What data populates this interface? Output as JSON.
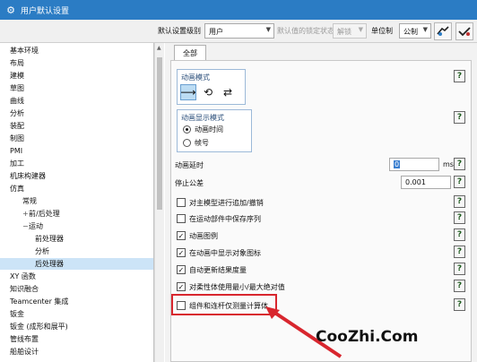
{
  "window": {
    "title": "用户默认设置"
  },
  "toolbar": {
    "default_level_label": "默认设置级别",
    "default_level_value": "用户",
    "lock_state_label": "默认值的锁定状态",
    "lock_state_value": "解锁",
    "unit_label": "单位制",
    "unit_value": "公制",
    "icons": [
      "settings-tool-icon",
      "check-tool-icon"
    ]
  },
  "sidebar": {
    "items": [
      {
        "label": "基本环境",
        "depth": 0,
        "expander": ""
      },
      {
        "label": "布局",
        "depth": 0,
        "expander": ""
      },
      {
        "label": "建模",
        "depth": 0,
        "expander": ""
      },
      {
        "label": "草图",
        "depth": 0,
        "expander": ""
      },
      {
        "label": "曲线",
        "depth": 0,
        "expander": ""
      },
      {
        "label": "分析",
        "depth": 0,
        "expander": ""
      },
      {
        "label": "装配",
        "depth": 0,
        "expander": ""
      },
      {
        "label": "制图",
        "depth": 0,
        "expander": ""
      },
      {
        "label": "PMI",
        "depth": 0,
        "expander": ""
      },
      {
        "label": "加工",
        "depth": 0,
        "expander": ""
      },
      {
        "label": "机床构建器",
        "depth": 0,
        "expander": ""
      },
      {
        "label": "仿真",
        "depth": 0,
        "expander": ""
      },
      {
        "label": "常规",
        "depth": 1,
        "expander": ""
      },
      {
        "label": "前/后处理",
        "depth": 1,
        "expander": "+"
      },
      {
        "label": "运动",
        "depth": 1,
        "expander": "−"
      },
      {
        "label": "前处理器",
        "depth": 2,
        "expander": ""
      },
      {
        "label": "分析",
        "depth": 2,
        "expander": ""
      },
      {
        "label": "后处理器",
        "depth": 2,
        "expander": "",
        "selected": true
      },
      {
        "label": "XY 函数",
        "depth": 0,
        "expander": ""
      },
      {
        "label": "知识融合",
        "depth": 0,
        "expander": ""
      },
      {
        "label": "Teamcenter 集成",
        "depth": 0,
        "expander": ""
      },
      {
        "label": "钣金",
        "depth": 0,
        "expander": ""
      },
      {
        "label": "钣金 (成形和展平)",
        "depth": 0,
        "expander": ""
      },
      {
        "label": "管线布置",
        "depth": 0,
        "expander": ""
      },
      {
        "label": "船舶设计",
        "depth": 0,
        "expander": ""
      }
    ]
  },
  "main": {
    "tab_label": "全部",
    "animation_mode": {
      "title": "动画模式",
      "icons": [
        "single-direction-icon",
        "loop-icon",
        "reciprocate-icon"
      ],
      "selected_index": 0
    },
    "display_mode": {
      "title": "动画显示模式",
      "options": [
        {
          "label": "动画时间",
          "checked": true
        },
        {
          "label": "帧号",
          "checked": false
        }
      ]
    },
    "delay": {
      "label": "动画延时",
      "value": "0",
      "unit": "ms"
    },
    "tolerance": {
      "label": "停止公差",
      "value": "0.001"
    },
    "checkboxes": [
      {
        "label": "对主模型进行追加/撤销",
        "checked": false
      },
      {
        "label": "在运动部件中保存序列",
        "checked": false
      },
      {
        "label": "动画图例",
        "checked": true
      },
      {
        "label": "在动画中显示对象图标",
        "checked": true
      },
      {
        "label": "自动更新结果度量",
        "checked": true
      },
      {
        "label": "对柔性体使用最小/最大绝对值",
        "checked": true
      },
      {
        "label": "组件和连杆仅测量计算体",
        "checked": false
      }
    ],
    "help_symbol": "?",
    "check_mark": "✓"
  },
  "watermark": {
    "text": "CooZhi.Com"
  },
  "colors": {
    "titlebar": "#2b7cc4",
    "selection": "#cce4f7",
    "highlight": "#d8262e"
  }
}
